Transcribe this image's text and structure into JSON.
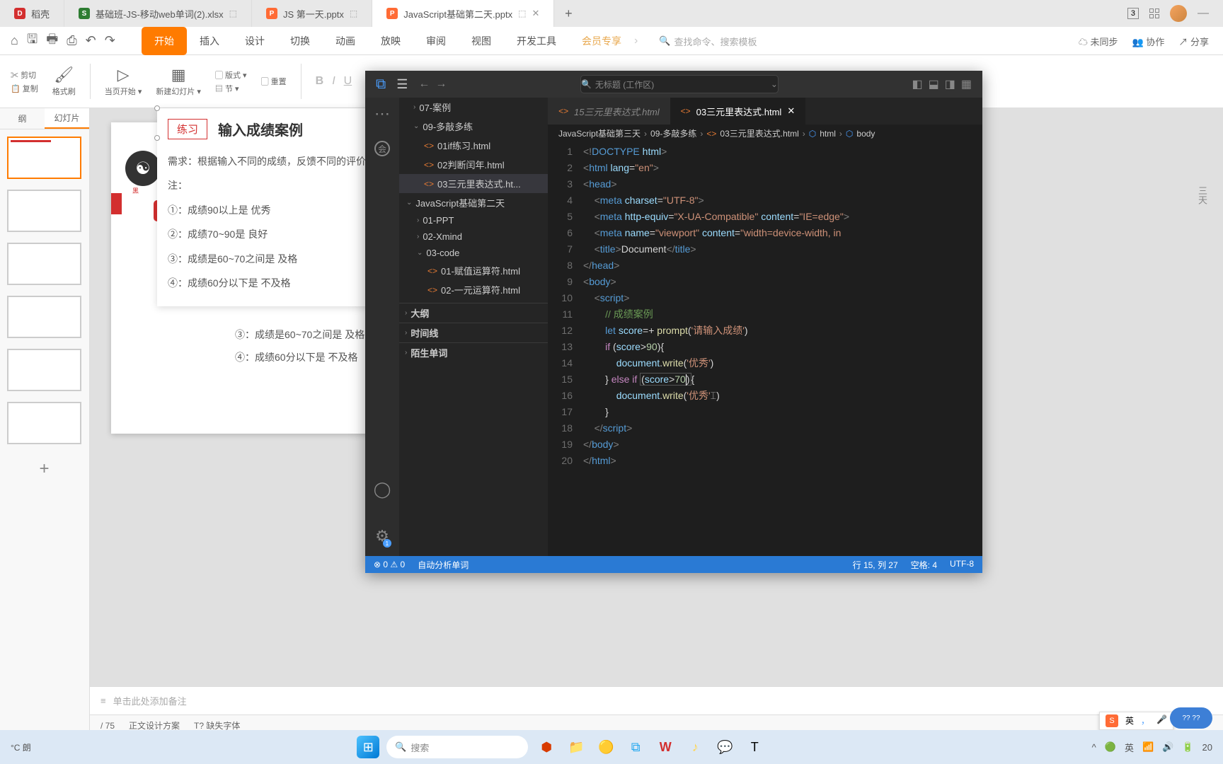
{
  "tabs": [
    {
      "icon_bg": "#d32f2f",
      "icon_text": "D",
      "label": "稻壳"
    },
    {
      "icon_bg": "#2e7d32",
      "icon_text": "S",
      "label": "基础班-JS-移动web单词(2).xlsx"
    },
    {
      "icon_bg": "#ff6b35",
      "icon_text": "P",
      "label": "JS 第一天.pptx"
    },
    {
      "icon_bg": "#ff6b35",
      "icon_text": "P",
      "label": "JavaScript基础第二天.pptx"
    }
  ],
  "tab_badge": "3",
  "menus": [
    "开始",
    "插入",
    "设计",
    "切换",
    "动画",
    "放映",
    "审阅",
    "视图",
    "开发工具",
    "会员专享"
  ],
  "search_placeholder": "查找命令、搜索模板",
  "top_right": {
    "sync": "未同步",
    "collab": "协作",
    "share": "分享"
  },
  "ribbon": {
    "cut": "剪切",
    "copy": "复制",
    "format": "格式刷",
    "start": "当页开始",
    "newslide": "新建幻灯片",
    "layout": "版式",
    "section": "节",
    "reset": "重置"
  },
  "panel_tabs": [
    "纲",
    "幻灯片"
  ],
  "practice": {
    "tag": "练习",
    "title": "输入成绩案例",
    "req": "需求：根据输入不同的成绩，反馈不同的评价",
    "note": "注：",
    "l1": "①：成绩90以上是  优秀",
    "l2": "②：成绩70~90是  良好",
    "l3": "③：成绩是60~70之间是  及格",
    "l4": "④：成绩60分以下是  不及格"
  },
  "below": {
    "l3": "③：成绩是60~70之间是  及格",
    "l4": "④：成绩60分以下是  不及格"
  },
  "notes_placeholder": "单击此处添加备注",
  "status_bar": {
    "page": "/ 75",
    "design": "正文设计方案",
    "font": "缺失字体"
  },
  "vscode": {
    "title": "无标题 (工作区)",
    "tabs": [
      {
        "label": "15三元里表达式.html",
        "active": false,
        "italic": true
      },
      {
        "label": "03三元里表达式.html",
        "active": true
      }
    ],
    "breadcrumb": [
      "JavaScript基础第三天",
      "09-多敲多练",
      "03三元里表达式.html",
      "html",
      "body"
    ],
    "explorer": [
      {
        "label": "07-案例",
        "indent": 1,
        "chev": "›",
        "type": "folder"
      },
      {
        "label": "09-多敲多练",
        "indent": 1,
        "chev": "⌄",
        "type": "folder"
      },
      {
        "label": "01if练习.html",
        "indent": 2,
        "type": "file"
      },
      {
        "label": "02判断闰年.html",
        "indent": 2,
        "type": "file"
      },
      {
        "label": "03三元里表达式.ht...",
        "indent": 2,
        "type": "file",
        "active": true
      },
      {
        "label": "JavaScript基础第二天",
        "indent": 0,
        "chev": "⌄",
        "type": "folder"
      },
      {
        "label": "01-PPT",
        "indent": 1,
        "chev": "›",
        "type": "folder"
      },
      {
        "label": "02-Xmind",
        "indent": 1,
        "chev": "›",
        "type": "folder"
      },
      {
        "label": "03-code",
        "indent": 1,
        "chev": "⌄",
        "type": "folder"
      },
      {
        "label": "01-赋值运算符.html",
        "indent": 2,
        "type": "file"
      },
      {
        "label": "02-一元运算符.html",
        "indent": 2,
        "type": "file"
      }
    ],
    "panels": [
      "大纲",
      "时间线",
      "陌生单词"
    ],
    "status": {
      "err": "0",
      "warn": "0",
      "analyze": "自动分析单词",
      "pos": "行 15, 列 27",
      "spaces": "空格: 4",
      "enc": "UTF-8"
    },
    "code_comment": "// 成绩案例",
    "code_prompt": "'请输入成绩'",
    "code_s1": "'优秀'",
    "code_s2": "'优秀'"
  },
  "taskbar": {
    "weather": "°C\n朗",
    "search": "搜索",
    "time": "20"
  },
  "ime": {
    "lang": "英"
  }
}
